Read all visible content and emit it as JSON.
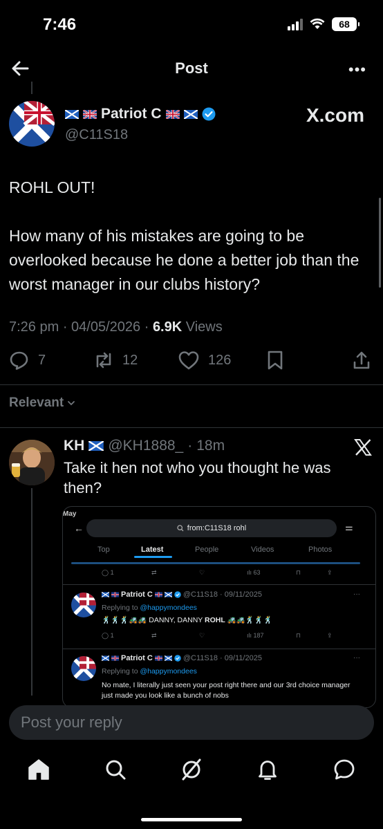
{
  "status_bar": {
    "time": "7:46",
    "battery": "68"
  },
  "header": {
    "title": "Post"
  },
  "post": {
    "display_name": "Patriot C",
    "handle": "@C11S18",
    "badge_text": "X.com",
    "line1": "ROHL OUT!",
    "line2": "How many of his mistakes are going to be overlooked because he done a better job than the worst manager in our clubs history?",
    "time": "7:26 pm",
    "date": "04/05/2026",
    "views_count": "6.9K",
    "views_label": "Views",
    "replies": "7",
    "reposts": "12",
    "likes": "126"
  },
  "sort_label": "Relevant",
  "reply": {
    "display_name": "KH",
    "handle": "@KH1888_",
    "age": "18m",
    "text": "Take it hen not who you thought he was then?",
    "screenshot": {
      "time": "May",
      "search_query": "from:C11S18 rohl",
      "tabs": [
        "Top",
        "Latest",
        "People",
        "Videos",
        "Photos"
      ],
      "row0_replies": "1",
      "row0_views": "63",
      "tweet1": {
        "name": "Patriot C",
        "meta": "@C11S18 · 09/11/2025",
        "replying_prefix": "Replying to",
        "replying_to": "@happymondees",
        "body_pre": "🕺🕺🕺🚜🚜 DANNY, DANNY",
        "body_bold": "ROHL",
        "body_post": "🚜🚜🕺🕺🕺",
        "replies": "1",
        "views": "187"
      },
      "tweet2": {
        "name": "Patriot C",
        "meta": "@C11S18 · 09/11/2025",
        "replying_prefix": "Replying to",
        "replying_to": "@happymondees",
        "body": "No mate, I literally just seen your post right there and our 3rd choice manager just made you look like a bunch of nobs"
      }
    }
  },
  "reply_box": {
    "placeholder": "Post your reply"
  },
  "nav": [
    "home-icon",
    "search-icon",
    "grok-icon",
    "notifications-icon",
    "messages-icon"
  ],
  "colors": {
    "accent": "#1d9bf0",
    "background": "#000000",
    "muted": "#71767b"
  }
}
